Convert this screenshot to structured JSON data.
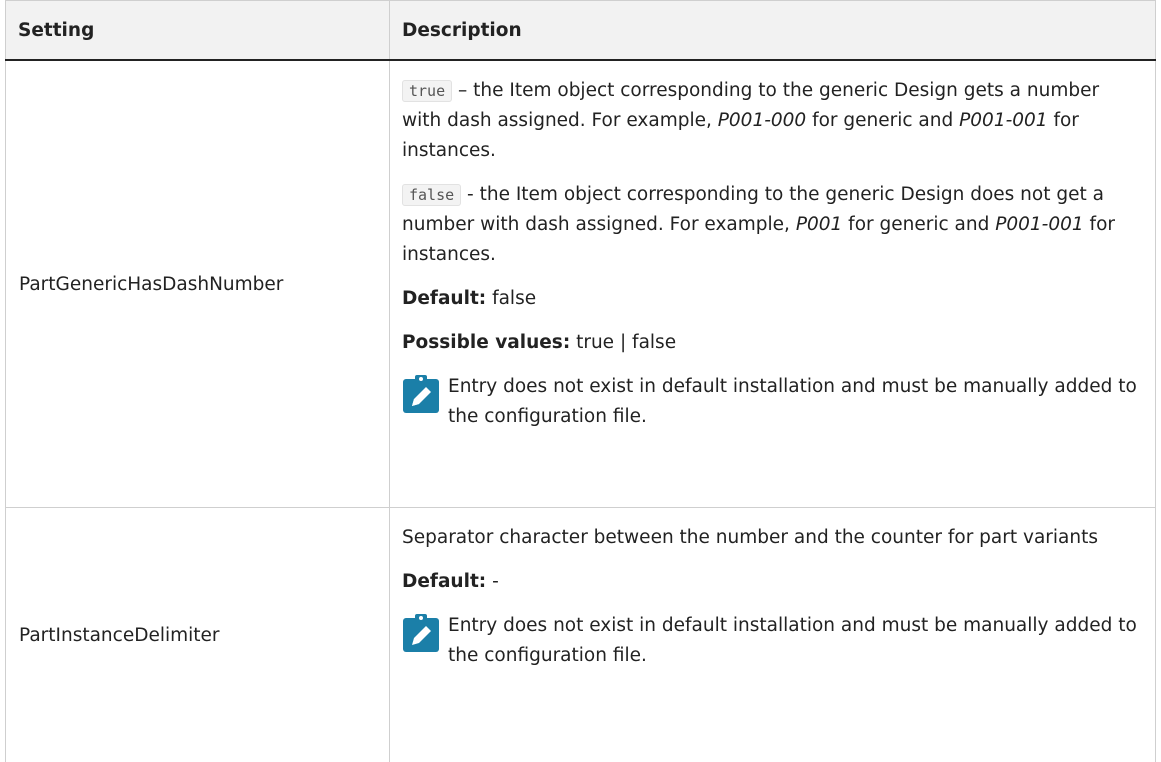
{
  "headers": {
    "setting": "Setting",
    "description": "Description"
  },
  "rows": [
    {
      "name": "PartGenericHasDashNumber",
      "true_code": "true",
      "true_text_1": " – the Item object corresponding to the generic Design gets a number with dash assigned. For example, ",
      "true_ex_1": "P001-000",
      "true_text_2": " for generic and ",
      "true_ex_2": "P001-001",
      "true_text_3": " for instances.",
      "false_code": "false",
      "false_text_1": " - the Item object corresponding to the generic Design does not get a number with dash assigned. For example, ",
      "false_ex_1": "P001",
      "false_text_2": " for generic and ",
      "false_ex_2": "P001-001",
      "false_text_3": " for instances.",
      "default_label": "Default:",
      "default_value": " false",
      "possible_label": "Possible values:",
      "possible_value": " true | false",
      "note": "Entry does not exist in default installation and must be manually added to the configuration file.",
      "note_icon": "pencil-note-icon"
    },
    {
      "name": "PartInstanceDelimiter",
      "description": "Separator character between the number and the counter for part variants",
      "default_label": "Default:",
      "default_value": " -",
      "note": "Entry does not exist in default installation and must be manually added to the configuration file.",
      "note_icon": "pencil-note-icon"
    }
  ],
  "colors": {
    "note_icon": "#1b7fa8",
    "header_bg": "#f2f2f2",
    "border": "#cfcfcf"
  }
}
